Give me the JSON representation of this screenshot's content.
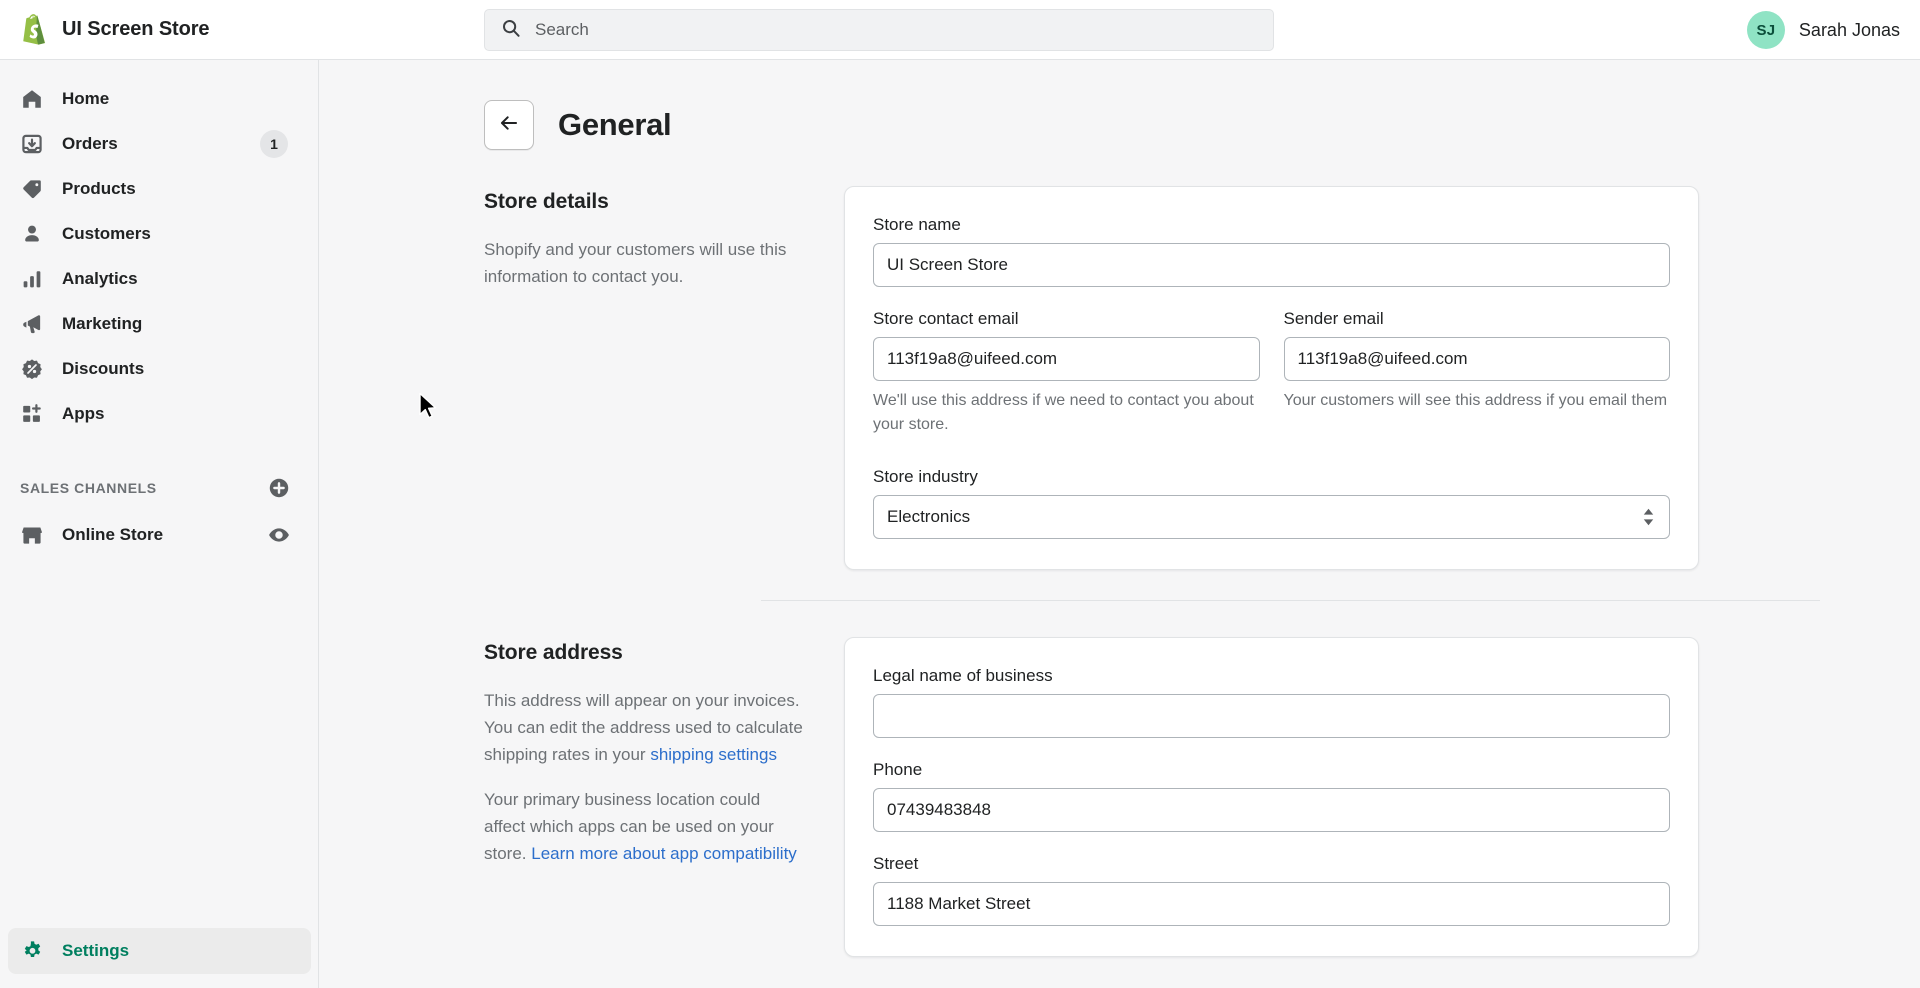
{
  "header": {
    "brand_name": "UI Screen Store",
    "logo_icon": "shopify-bag-icon",
    "search": {
      "icon": "search-icon",
      "placeholder": "Search",
      "value": ""
    },
    "user": {
      "initials": "SJ",
      "name": "Sarah Jonas"
    }
  },
  "sidebar": {
    "items": [
      {
        "label": "Home",
        "icon": "home-icon",
        "badge": null
      },
      {
        "label": "Orders",
        "icon": "orders-inbox-icon",
        "badge": "1"
      },
      {
        "label": "Products",
        "icon": "tag-icon",
        "badge": null
      },
      {
        "label": "Customers",
        "icon": "person-icon",
        "badge": null
      },
      {
        "label": "Analytics",
        "icon": "bar-chart-icon",
        "badge": null
      },
      {
        "label": "Marketing",
        "icon": "megaphone-icon",
        "badge": null
      },
      {
        "label": "Discounts",
        "icon": "discount-badge-icon",
        "badge": null
      },
      {
        "label": "Apps",
        "icon": "apps-grid-plus-icon",
        "badge": null
      }
    ],
    "sales_channels": {
      "title": "SALES CHANNELS",
      "add_icon": "plus-circle-icon",
      "channels": [
        {
          "label": "Online Store",
          "icon": "storefront-icon",
          "action_icon": "eye-icon"
        }
      ]
    },
    "settings": {
      "label": "Settings",
      "icon": "gear-icon",
      "active": true,
      "accent_color": "#007f5f"
    }
  },
  "page": {
    "back_icon": "arrow-left-icon",
    "title": "General"
  },
  "store_details": {
    "heading": "Store details",
    "description": "Shopify and your customers will use this information to contact you.",
    "fields": {
      "store_name": {
        "label": "Store name",
        "value": "UI Screen Store"
      },
      "store_contact_email": {
        "label": "Store contact email",
        "value": "113f19a8@uifeed.com",
        "help": "We'll use this address if we need to contact you about your store."
      },
      "sender_email": {
        "label": "Sender email",
        "value": "113f19a8@uifeed.com",
        "help": "Your customers will see this address if you email them"
      },
      "store_industry": {
        "label": "Store industry",
        "value": "Electronics",
        "options": [
          "Electronics"
        ]
      }
    }
  },
  "store_address": {
    "heading": "Store address",
    "description_1_prefix": "This address will appear on your invoices. You can edit the address used to calculate shipping rates in your ",
    "description_1_link": "shipping settings",
    "description_2_prefix": "Your primary business location could affect which apps can be used on your store. ",
    "description_2_link": "Learn more about app compatibility",
    "fields": {
      "legal_name": {
        "label": "Legal name of business",
        "value": ""
      },
      "phone": {
        "label": "Phone",
        "value": "07439483848"
      },
      "street": {
        "label": "Street",
        "value": "1188 Market Street"
      }
    }
  },
  "colors": {
    "accent_green": "#007f5f",
    "link_blue": "#2c6ecb",
    "avatar_bg": "#8fe3c4",
    "page_bg": "#f6f6f7",
    "card_bg": "#ffffff"
  }
}
